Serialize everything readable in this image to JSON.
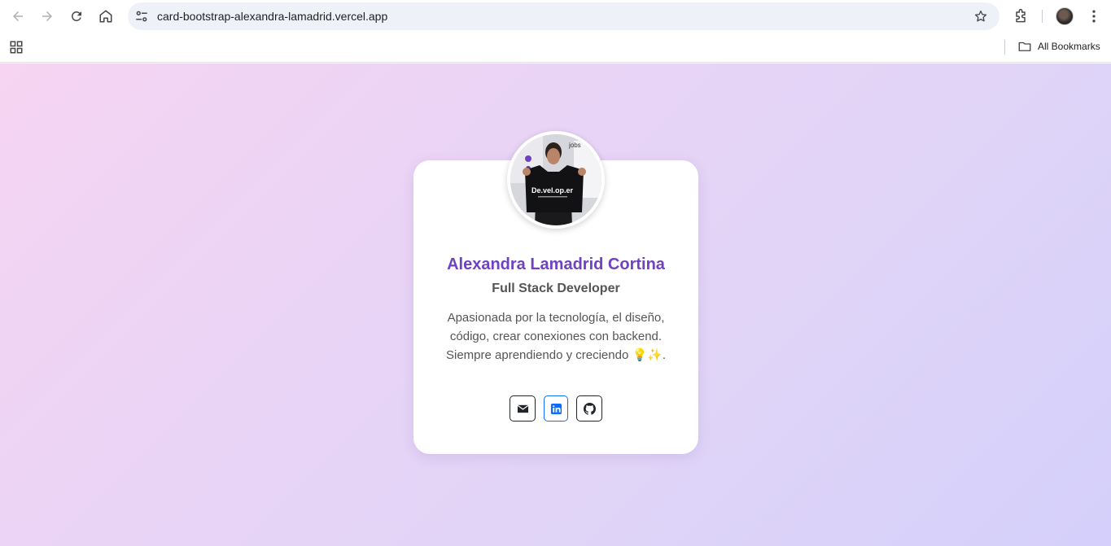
{
  "browser": {
    "url": "card-bootstrap-alexandra-lamadrid.vercel.app",
    "all_bookmarks": "All Bookmarks"
  },
  "profile": {
    "name": "Alexandra Lamadrid Cortina",
    "role": "Full Stack Developer",
    "bio": "Apasionada por la tecnología, el diseño, código, crear conexiones con backend. Siempre aprendiendo y creciendo 💡✨.",
    "photo_shirt_text": "De.vel.op.er",
    "photo_banner_text": "jobs"
  },
  "socials": [
    {
      "name": "email",
      "icon": "envelope-icon"
    },
    {
      "name": "linkedin",
      "icon": "linkedin-icon"
    },
    {
      "name": "github",
      "icon": "github-icon"
    }
  ],
  "colors": {
    "name": "#6f42c1",
    "linkedin": "#0d6efd",
    "gradient_start": "#f6d4f2",
    "gradient_end": "#d4d0fb"
  }
}
